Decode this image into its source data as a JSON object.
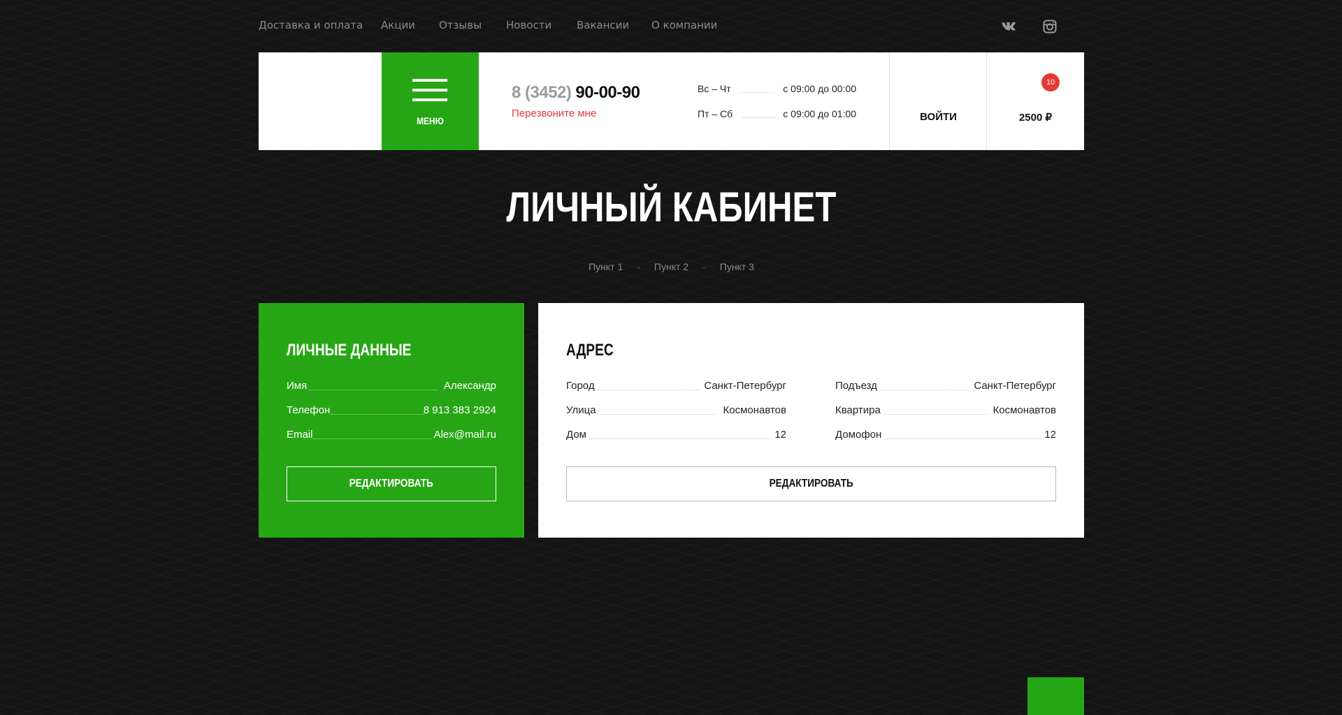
{
  "topnav": {
    "items": [
      {
        "label": "Доставка и оплата"
      },
      {
        "label": "Акции"
      },
      {
        "label": "Отзывы"
      },
      {
        "label": "Новости"
      },
      {
        "label": "Вакансии"
      },
      {
        "label": "О компании"
      }
    ],
    "social": [
      {
        "icon": "vk-icon"
      },
      {
        "icon": "instagram-icon"
      }
    ]
  },
  "header": {
    "menu_label": "МЕНЮ",
    "phone_code": "8 (3452)",
    "phone_number": "90-00-90",
    "callback_label": "Перезвоните мне",
    "hours": [
      {
        "days": "Вс – Чт",
        "time": "с 09:00 до 00:00"
      },
      {
        "days": "Пт – Сб",
        "time": "с 09:00 до 01:00"
      }
    ],
    "login_label": "ВОЙТИ",
    "cart_count": "10",
    "cart_total": "2500 ₽"
  },
  "page": {
    "title": "ЛИЧНЫЙ КАБИНЕТ",
    "breadcrumb": [
      "Пункт 1",
      "Пункт 2",
      "Пункт 3"
    ],
    "breadcrumb_sep": "-"
  },
  "personal": {
    "title": "ЛИЧНЫЕ ДАННЫЕ",
    "fields": [
      {
        "label": "Имя",
        "value": "Александр"
      },
      {
        "label": "Телефон",
        "value": "8 913 383 2924"
      },
      {
        "label": "Email",
        "value": "Alex@mail.ru"
      }
    ],
    "edit_label": "РЕДАКТИРОВАТЬ"
  },
  "address": {
    "title": "АДРЕС",
    "left_fields": [
      {
        "label": "Город",
        "value": "Санкт-Петербург"
      },
      {
        "label": "Улица",
        "value": "Космонавтов"
      },
      {
        "label": "Дом",
        "value": "12"
      }
    ],
    "right_fields": [
      {
        "label": "Подъезд",
        "value": "Санкт-Петербург"
      },
      {
        "label": "Квартира",
        "value": "Космонавтов"
      },
      {
        "label": "Домофон",
        "value": "12"
      }
    ],
    "edit_label": "РЕДАКТИРОВАТЬ"
  },
  "colors": {
    "accent": "#27a615",
    "danger": "#e53935",
    "background": "#141414"
  }
}
